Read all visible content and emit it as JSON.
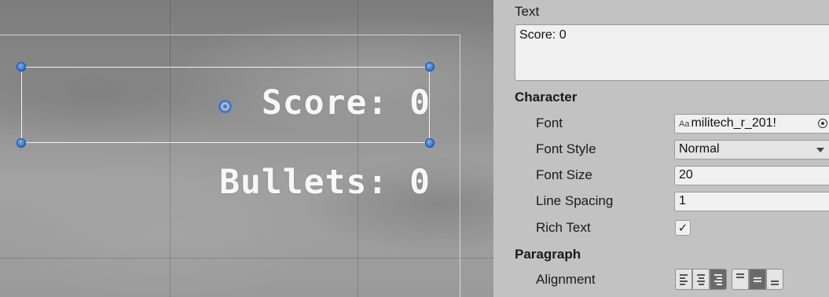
{
  "scene": {
    "score_text": "Score: 0",
    "bullets_text": "Bullets: 0"
  },
  "inspector": {
    "text_label": "Text",
    "text_value": "Score: 0",
    "character_header": "Character",
    "font": {
      "label": "Font",
      "prefix": "Aa",
      "value": "militech_r_201!",
      "icon": "object-picker-icon"
    },
    "font_style": {
      "label": "Font Style",
      "value": "Normal"
    },
    "font_size": {
      "label": "Font Size",
      "value": "20"
    },
    "line_spacing": {
      "label": "Line Spacing",
      "value": "1"
    },
    "rich_text": {
      "label": "Rich Text",
      "checked": true,
      "mark": "✓"
    },
    "paragraph_header": "Paragraph",
    "alignment": {
      "label": "Alignment",
      "horizontal": [
        "align-left",
        "align-center",
        "align-right"
      ],
      "horizontal_selected": "align-right",
      "vertical": [
        "align-top",
        "align-middle",
        "align-bottom"
      ],
      "vertical_selected": "align-middle"
    }
  },
  "colors": {
    "handle_blue": "#2d6fd1",
    "panel_bg": "#c2c2c2",
    "active_button": "#6a6a6a"
  }
}
